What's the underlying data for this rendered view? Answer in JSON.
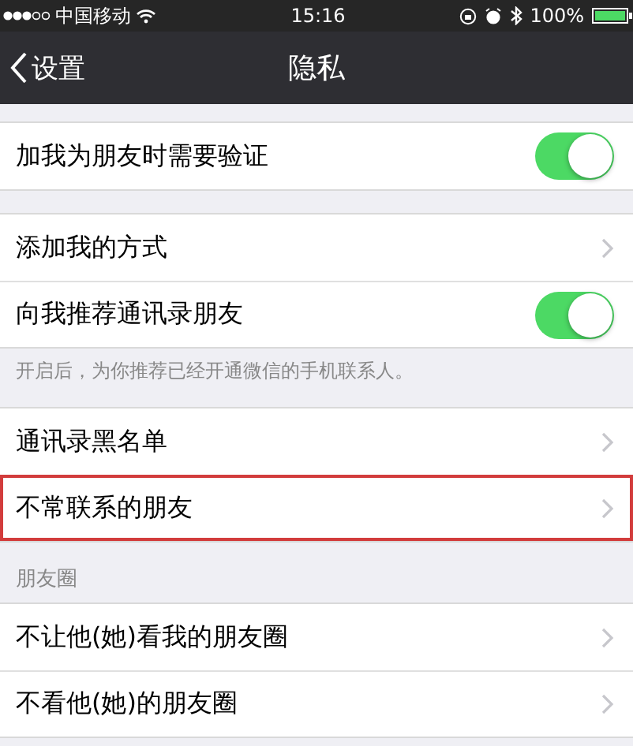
{
  "status_bar": {
    "carrier": "中国移动",
    "time": "15:16",
    "battery": "100%"
  },
  "nav_bar": {
    "back": "设置",
    "title": "隐私"
  },
  "groups": [
    {
      "items": [
        {
          "label": "加我为朋友时需要验证",
          "kind": "toggle",
          "on": true
        }
      ]
    },
    {
      "items": [
        {
          "label": "添加我的方式",
          "kind": "link"
        },
        {
          "label": "向我推荐通讯录朋友",
          "kind": "toggle",
          "on": true
        }
      ],
      "footer": "开启后，为你推荐已经开通微信的手机联系人。"
    },
    {
      "items": [
        {
          "label": "通讯录黑名单",
          "kind": "link",
          "highlighted": false
        },
        {
          "label": "不常联系的朋友",
          "kind": "link",
          "highlighted": true
        }
      ]
    },
    {
      "header": "朋友圈",
      "items": [
        {
          "label": "不让他(她)看我的朋友圈",
          "kind": "link"
        },
        {
          "label": "不看他(她)的朋友圈",
          "kind": "link"
        }
      ]
    }
  ]
}
